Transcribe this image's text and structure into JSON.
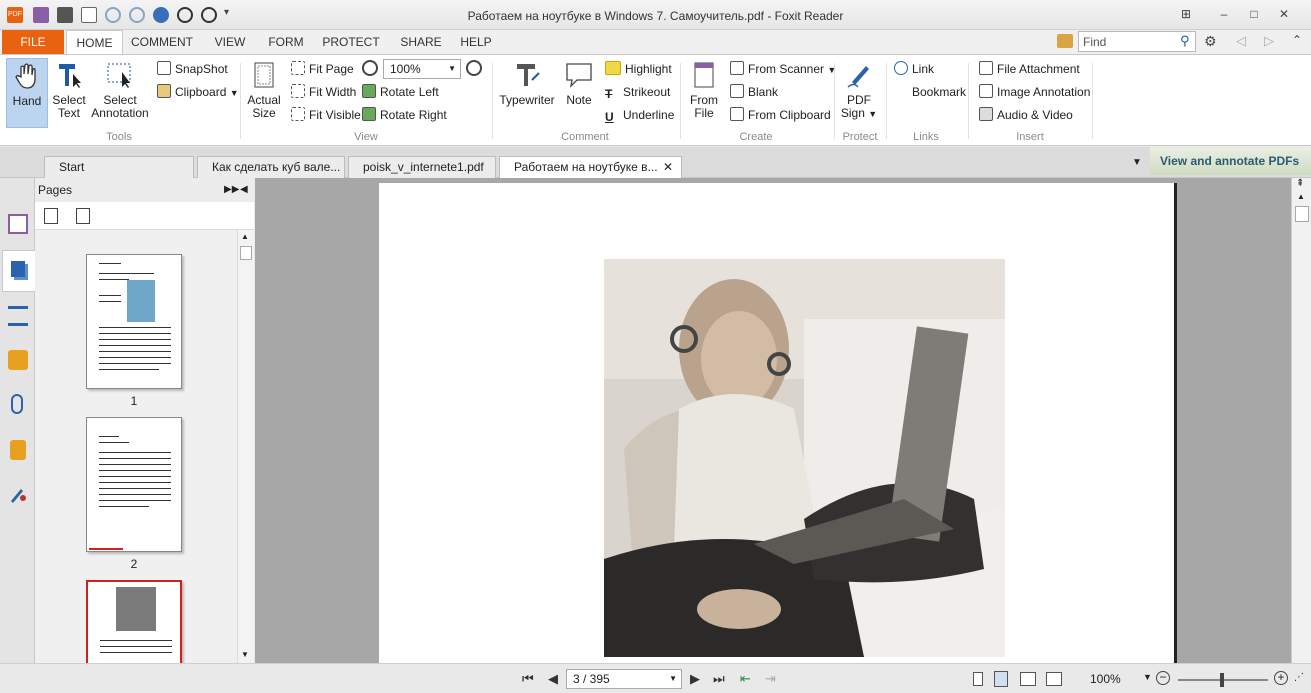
{
  "window": {
    "title": "Работаем на ноутбуке в Windows 7. Самоучитель.pdf - Foxit Reader"
  },
  "menu": {
    "file": "FILE",
    "home": "HOME",
    "comment": "COMMENT",
    "view": "VIEW",
    "form": "FORM",
    "protect": "PROTECT",
    "share": "SHARE",
    "help": "HELP",
    "find_placeholder": "Find"
  },
  "ribbon": {
    "tools": {
      "hand": "Hand",
      "select_text": [
        "Select",
        "Text"
      ],
      "select_annotation": [
        "Select",
        "Annotation"
      ],
      "snapshot": "SnapShot",
      "clipboard": "Clipboard",
      "group": "Tools"
    },
    "view": {
      "actual_size": [
        "Actual",
        "Size"
      ],
      "fit_page": "Fit Page",
      "fit_width": "Fit Width",
      "fit_visible": "Fit Visible",
      "zoom_value": "100%",
      "rotate_left": "Rotate Left",
      "rotate_right": "Rotate Right",
      "group": "View"
    },
    "comment": {
      "typewriter": "Typewriter",
      "note": "Note",
      "highlight": "Highlight",
      "strikeout": "Strikeout",
      "underline": "Underline",
      "group": "Comment"
    },
    "create": {
      "from_file": [
        "From",
        "File"
      ],
      "from_scanner": "From Scanner",
      "blank": "Blank",
      "from_clipboard": "From Clipboard",
      "group": "Create"
    },
    "protect": {
      "pdf_sign": [
        "PDF",
        "Sign"
      ],
      "group": "Protect"
    },
    "links": {
      "link": "Link",
      "bookmark": "Bookmark",
      "group": "Links"
    },
    "insert": {
      "file_attachment": "File Attachment",
      "image_annotation": "Image Annotation",
      "audio_video": "Audio & Video",
      "group": "Insert"
    }
  },
  "tabs": [
    {
      "label": "Start"
    },
    {
      "label": "Как сделать куб вале..."
    },
    {
      "label": "poisk_v_internete1.pdf"
    },
    {
      "label": "Работаем на ноутбуке в..."
    }
  ],
  "annotate_banner": "View and annotate PDFs",
  "pages_panel": {
    "title": "Pages",
    "thumbnails": [
      {
        "number": "1"
      },
      {
        "number": "2"
      },
      {
        "number": ""
      }
    ]
  },
  "status": {
    "page_field": "3 / 395",
    "zoom": "100%"
  },
  "colors": {
    "file_tab": "#e8620f",
    "hand_selected": "#bcd4f0",
    "annot_text": "#2a5b73",
    "thumb_selected_border": "#d21f1f"
  }
}
